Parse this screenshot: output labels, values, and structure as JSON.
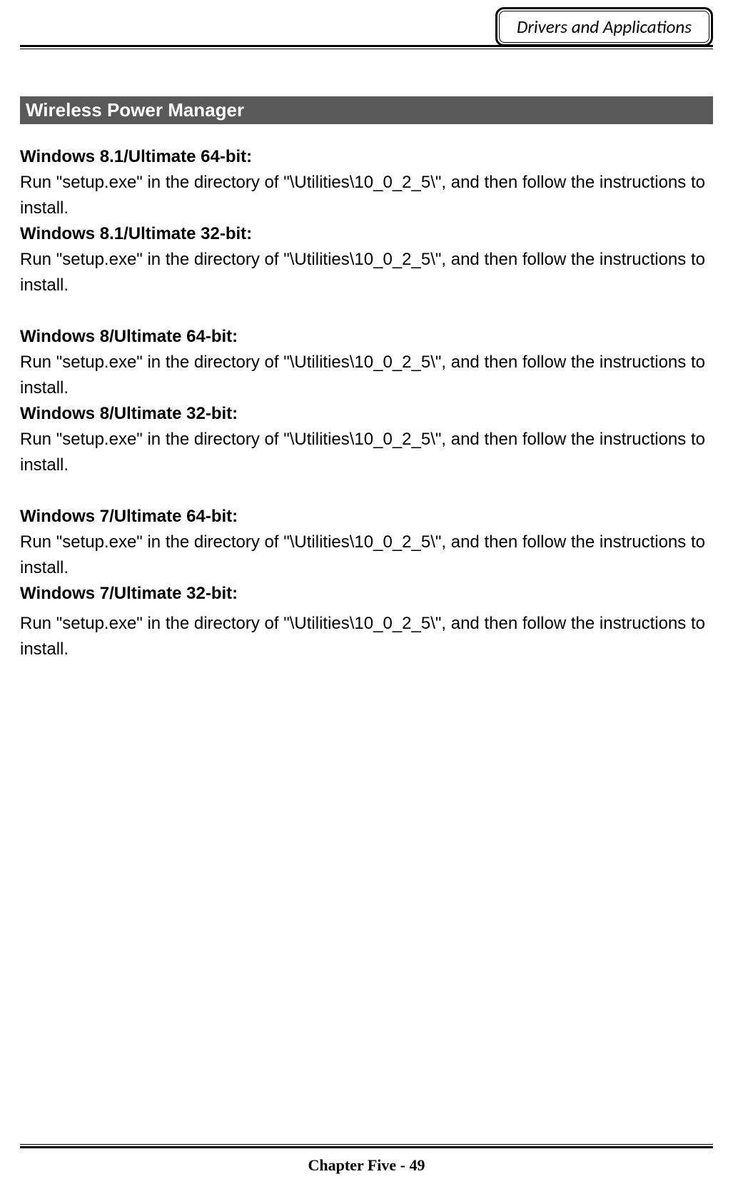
{
  "header": {
    "badge": "Drivers and Applications"
  },
  "section": {
    "title": " Wireless Power Manager"
  },
  "groups": [
    {
      "entries": [
        {
          "heading": "Windows 8.1/Ultimate 64-bit:",
          "text": "Run \"setup.exe\" in the directory of \"\\Utilities\\10_0_2_5\\\", and then follow the instructions to install."
        },
        {
          "heading": "Windows 8.1/Ultimate 32-bit:",
          "text": "Run \"setup.exe\" in the directory of \"\\Utilities\\10_0_2_5\\\", and then follow the instructions to install."
        }
      ]
    },
    {
      "entries": [
        {
          "heading": "Windows 8/Ultimate 64-bit:",
          "text": "Run \"setup.exe\" in the directory of \"\\Utilities\\10_0_2_5\\\", and then follow the instructions to install."
        },
        {
          "heading": "Windows 8/Ultimate 32-bit:",
          "text": "Run \"setup.exe\" in the directory of \"\\Utilities\\10_0_2_5\\\", and then follow the instructions to install."
        }
      ]
    },
    {
      "entries": [
        {
          "heading": "Windows 7/Ultimate 64-bit:",
          "text": "Run \"setup.exe\" in the directory of \"\\Utilities\\10_0_2_5\\\", and then follow the instructions to install."
        },
        {
          "heading": "Windows 7/Ultimate 32-bit:",
          "text": "Run \"setup.exe\" in the directory of \"\\Utilities\\10_0_2_5\\\", and then follow the instructions to install."
        }
      ]
    }
  ],
  "footer": {
    "text": "Chapter Five - 49"
  }
}
